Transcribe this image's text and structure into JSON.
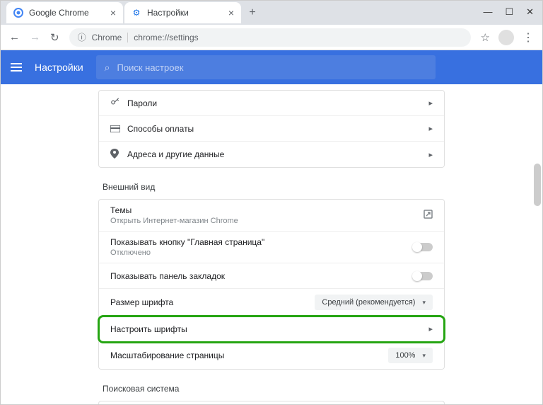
{
  "window": {
    "min": "—",
    "max": "☐",
    "close": "✕"
  },
  "tabs": [
    {
      "title": "Google Chrome",
      "favicon": "chrome"
    },
    {
      "title": "Настройки",
      "favicon": "gear"
    }
  ],
  "newtab": "+",
  "nav": {
    "back": "←",
    "forward": "→",
    "reload": "↻"
  },
  "omnibox": {
    "info": "ⓘ",
    "label": "Chrome",
    "url": "chrome://settings"
  },
  "star": "☆",
  "menu": "⋮",
  "header": {
    "title": "Настройки"
  },
  "search": {
    "placeholder": "Поиск настроек"
  },
  "autofill": {
    "passwords": "Пароли",
    "payment": "Способы оплаты",
    "addresses": "Адреса и другие данные"
  },
  "appearance": {
    "title": "Внешний вид",
    "themes": {
      "label": "Темы",
      "sub": "Открыть Интернет-магазин Chrome"
    },
    "home": {
      "label": "Показывать кнопку \"Главная страница\"",
      "sub": "Отключено"
    },
    "bookmarks": "Показывать панель закладок",
    "fontsize": {
      "label": "Размер шрифта",
      "value": "Средний (рекомендуется)"
    },
    "fonts": "Настроить шрифты",
    "zoom": {
      "label": "Масштабирование страницы",
      "value": "100%"
    }
  },
  "search_engine": {
    "title": "Поисковая система"
  },
  "icons": {
    "key": "⚿",
    "card": "▭",
    "pin": "⬢",
    "ext": "↗",
    "chev": "▸",
    "caret": "▾",
    "search": "🔍"
  }
}
